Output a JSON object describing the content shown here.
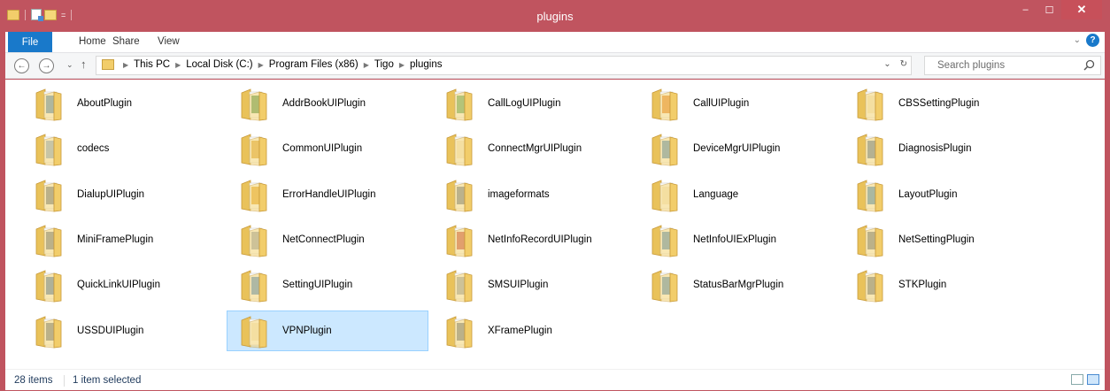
{
  "window": {
    "title": "plugins",
    "minimize": "–",
    "maximize": "☐",
    "close": "✕"
  },
  "ribbon": {
    "tabs": [
      "File",
      "Home",
      "Share",
      "View"
    ]
  },
  "nav": {
    "back": "←",
    "forward": "→",
    "up": "↑",
    "breadcrumbs": [
      "This PC",
      "Local Disk (C:)",
      "Program Files (x86)",
      "Tigo",
      "plugins"
    ],
    "refresh": "↻",
    "dropdown": "⌄"
  },
  "search": {
    "placeholder": "Search plugins"
  },
  "items": [
    {
      "name": "AboutPlugin",
      "accent": "#3d7cc2"
    },
    {
      "name": "AddrBookUIPlugin",
      "accent": "#3f8a4a"
    },
    {
      "name": "CallLogUIPlugin",
      "accent": "#4aa060"
    },
    {
      "name": "CallUIPlugin",
      "accent": "#e07a20"
    },
    {
      "name": "CBSSettingPlugin",
      "accent": "#f0e6c8"
    },
    {
      "name": "codecs",
      "accent": "#7aa3d6"
    },
    {
      "name": "CommonUIPlugin",
      "accent": "#d8a030"
    },
    {
      "name": "ConnectMgrUIPlugin",
      "accent": "#f0e6c8"
    },
    {
      "name": "DeviceMgrUIPlugin",
      "accent": "#3b7fc4"
    },
    {
      "name": "DiagnosisPlugin",
      "accent": "#4a6fa0"
    },
    {
      "name": "DialupUIPlugin",
      "accent": "#5a6e88"
    },
    {
      "name": "ErrorHandleUIPlugin",
      "accent": "#e0a020"
    },
    {
      "name": "imageformats",
      "accent": "#5a7090"
    },
    {
      "name": "Language",
      "accent": "#f0e6c8"
    },
    {
      "name": "LayoutPlugin",
      "accent": "#2f80c8"
    },
    {
      "name": "MiniFramePlugin",
      "accent": "#5a6e88"
    },
    {
      "name": "NetConnectPlugin",
      "accent": "#8a9ab0"
    },
    {
      "name": "NetInfoRecordUIPlugin",
      "accent": "#c04040"
    },
    {
      "name": "NetInfoUIExPlugin",
      "accent": "#3b7fc4"
    },
    {
      "name": "NetSettingPlugin",
      "accent": "#5a6e88"
    },
    {
      "name": "QuickLinkUIPlugin",
      "accent": "#3b6fb4"
    },
    {
      "name": "SettingUIPlugin",
      "accent": "#3a80d0"
    },
    {
      "name": "SMSUIPlugin",
      "accent": "#8a9ab0"
    },
    {
      "name": "StatusBarMgrPlugin",
      "accent": "#3b7fc4"
    },
    {
      "name": "STKPlugin",
      "accent": "#5a6e88"
    },
    {
      "name": "USSDUIPlugin",
      "accent": "#5a6e88"
    },
    {
      "name": "VPNPlugin",
      "accent": "#f0e6c8",
      "selected": true
    },
    {
      "name": "XFramePlugin",
      "accent": "#5a6e88"
    }
  ],
  "status": {
    "count": "28 items",
    "selection": "1 item selected"
  },
  "colors": {
    "titlebar": "#c0545f",
    "file_tab": "#1979ca",
    "selection": "#cce8ff",
    "folder": "#f2cd6a"
  }
}
